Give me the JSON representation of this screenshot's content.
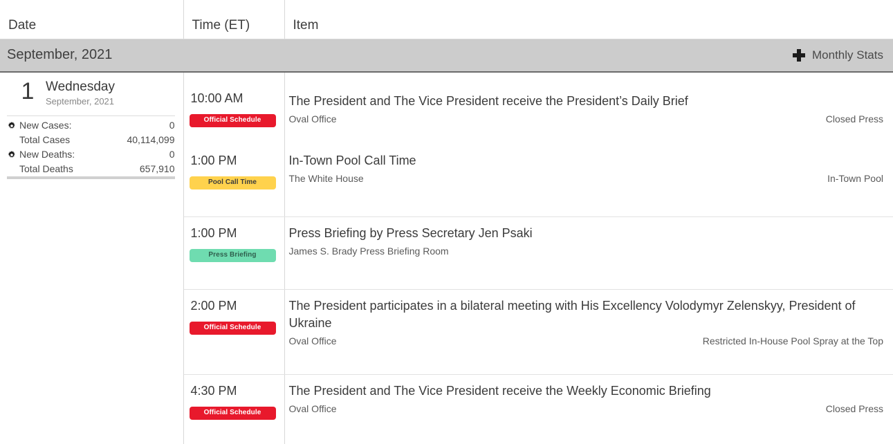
{
  "table": {
    "headers": {
      "date": "Date",
      "time": "Time (ET)",
      "item": "Item"
    }
  },
  "month_band": {
    "label": "September, 2021",
    "monthly_stats_label": "Monthly Stats",
    "plus_icon": "plus-icon",
    "background": "#cccccc"
  },
  "day": {
    "number": "1",
    "weekday": "Wednesday",
    "month_year": "September, 2021",
    "stats": [
      {
        "icon": "gear-icon",
        "label": "New Cases:",
        "value": "0"
      },
      {
        "icon": "",
        "label": "Total Cases",
        "value": "40,114,099"
      },
      {
        "icon": "gear-icon",
        "label": "New Deaths:",
        "value": "0"
      },
      {
        "icon": "",
        "label": "Total Deaths",
        "value": "657,910"
      }
    ]
  },
  "badges": {
    "official": {
      "text": "Official Schedule",
      "bg": "#e8192c",
      "fg": "#ffffff"
    },
    "pool": {
      "text": "Pool Call Time",
      "bg": "#ffd24d",
      "fg": "#3b3b3b"
    },
    "press": {
      "text": "Press Briefing",
      "bg": "#6fdcb0",
      "fg": "#2f5f4d"
    }
  },
  "events": [
    {
      "time": "10:00 AM",
      "badge_text": "Official Schedule",
      "badge_type": "official",
      "title": "The President and The Vice President receive the President’s Daily Brief",
      "location": "Oval Office",
      "press": "Closed Press"
    },
    {
      "time": "1:00 PM",
      "badge_text": "Pool Call Time",
      "badge_type": "pool",
      "title": "In-Town Pool Call Time",
      "location": "The White House",
      "press": "In-Town Pool"
    },
    {
      "time": "1:00 PM",
      "badge_text": "Press Briefing",
      "badge_type": "press",
      "title": "Press Briefing by Press Secretary Jen Psaki",
      "location": "James S. Brady Press Briefing Room",
      "press": ""
    },
    {
      "time": "2:00 PM",
      "badge_text": "Official Schedule",
      "badge_type": "official",
      "title": "The President participates in a bilateral meeting with His Excellency Volodymyr Zelenskyy, President of Ukraine",
      "location": "Oval Office",
      "press": "Restricted In-House Pool Spray at the Top"
    },
    {
      "time": "4:30 PM",
      "badge_text": "Official Schedule",
      "badge_type": "official",
      "title": "The President and The Vice President receive the Weekly Economic Briefing",
      "location": "Oval Office",
      "press": "Closed Press"
    }
  ]
}
